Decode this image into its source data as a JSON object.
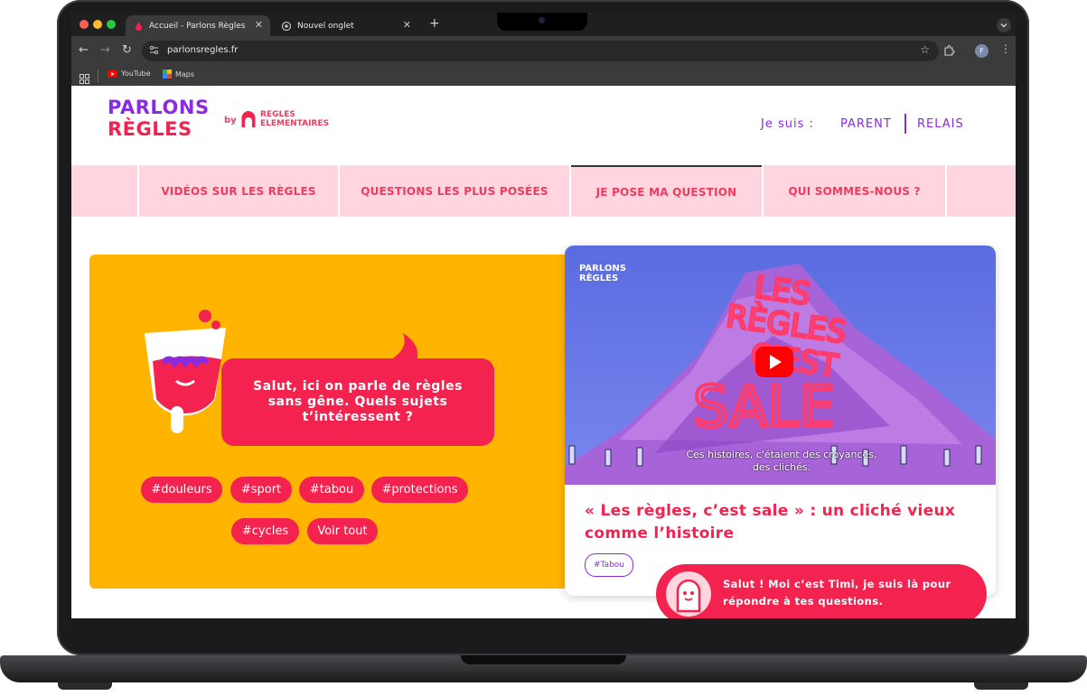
{
  "browser": {
    "tabs": [
      {
        "title": "Accueil - Parlons Règles",
        "active": true
      },
      {
        "title": "Nouvel onglet",
        "active": false
      }
    ],
    "new_tab_symbol": "+",
    "close_symbol": "✕",
    "url": "parlonsregles.fr",
    "bookmarks": [
      {
        "label": "YouTube",
        "icon": "youtube-icon"
      },
      {
        "label": "Maps",
        "icon": "maps-icon"
      }
    ],
    "profile_initial": "F",
    "colors": {
      "chrome_dark": "#1f1f1f",
      "chrome_mid": "#3b3b3b"
    }
  },
  "site": {
    "logo_line1": "PARLONS",
    "logo_line2": "RÈGLES",
    "by_label": "by",
    "partner_line1": "REGLES",
    "partner_line2": "ELEMENTAIRES",
    "je_suis": "Je suis :",
    "role_parent": "PARENT",
    "role_relais": "RELAIS",
    "colors": {
      "brand_red": "#f3224f",
      "brand_purple": "#8a2be2",
      "menu_pink": "#ffd6df",
      "hero_yellow": "#ffb400"
    }
  },
  "menu": {
    "items": [
      {
        "label": "VIDÉOS SUR LES RÈGLES"
      },
      {
        "label": "QUESTIONS LES PLUS POSÉES"
      },
      {
        "label": "JE POSE MA QUESTION"
      },
      {
        "label": "QUI SOMMES-NOUS ?"
      }
    ]
  },
  "hero": {
    "bubble_text": "Salut, ici on parle de règles sans gêne. Quels sujets t’intéressent ?",
    "tags": [
      "#douleurs",
      "#sport",
      "#tabou",
      "#protections",
      "#cycles"
    ],
    "see_all": "Voir tout"
  },
  "video": {
    "overlay_logo_line1": "PARLONS",
    "overlay_logo_line2": "RÈGLES",
    "title_art": [
      "LES",
      "RÈGLES",
      "C'EST",
      "SALE"
    ],
    "subtitle_line1": "Ces histoires, c'étaient des croyances,",
    "subtitle_line2": "des clichés.",
    "title": "« Les règles, c’est sale » : un cliché vieux comme l’histoire",
    "tag": "#Tabou"
  },
  "chat": {
    "text": "Salut ! Moi c’est Timi, je suis là pour répondre à tes questions."
  }
}
